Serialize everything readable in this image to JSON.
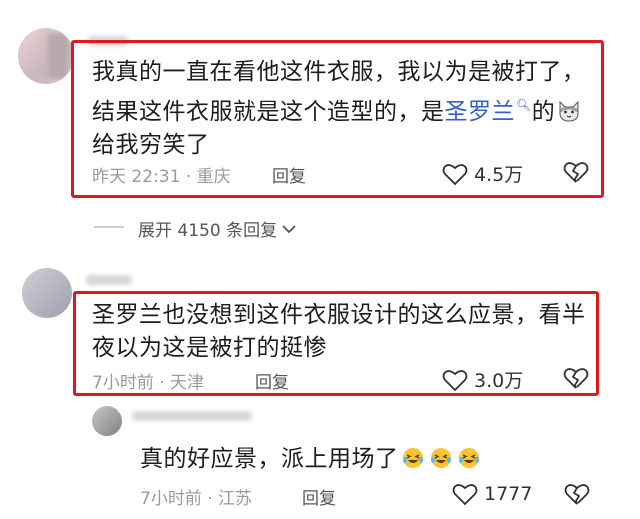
{
  "comments": [
    {
      "text_before_link": "我真的一直在看他这件衣服，我以为是被打了，结果这件衣服就是这个造型的，是",
      "link_text": "圣罗兰",
      "link_icon": "search-icon",
      "text_after_link_1": "的",
      "inline_emoji": "cat-face-emoji",
      "text_after_link_2": "给我穷笑了",
      "time": "昨天 22:31",
      "location": "重庆",
      "reply_label": "回复",
      "likes": "4.5万"
    },
    {
      "text": "圣罗兰也没想到这件衣服设计的这么应景，看半夜以为这是被打的挺惨",
      "time": "7小时前",
      "location": "天津",
      "reply_label": "回复",
      "likes": "3.0万"
    }
  ],
  "expand_replies": {
    "label": "展开 4150 条回复"
  },
  "sub_reply": {
    "username": "…",
    "text": "真的好应景，派上用场了",
    "emojis": [
      "laughing-crying-emoji",
      "laughing-crying-emoji",
      "laughing-crying-emoji"
    ],
    "time": "7小时前",
    "location": "江苏",
    "reply_label": "回复",
    "likes": "1777"
  },
  "colors": {
    "highlight_border": "#e0191e",
    "link": "#3560c7",
    "meta": "#9a9a9a",
    "emoji": "#f7c531"
  }
}
